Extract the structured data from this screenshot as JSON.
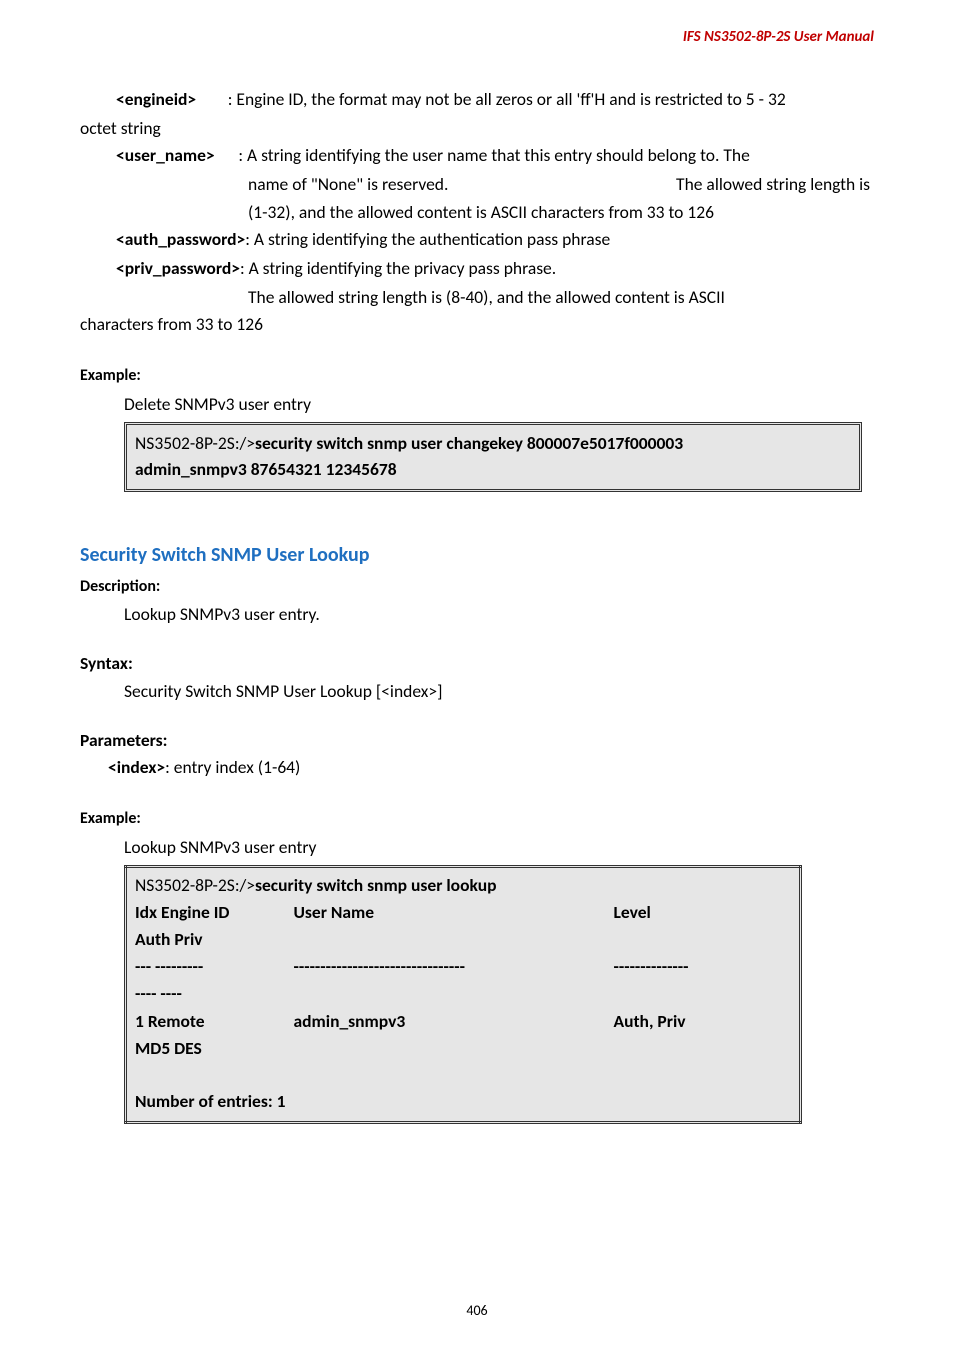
{
  "header": {
    "product": "IFS NS3502-8P-2S  User  Manual"
  },
  "params1": {
    "engineid": {
      "name": "<engineid>",
      "desc": ": Engine ID, the format may not be all zeros or all 'ff'H and is restricted to 5 - 32",
      "cont": "octet string"
    },
    "user_name": {
      "name": "<user_name>",
      "l1a": ": A string identifying the user name that this entry should belong to. The",
      "l2a": "name of \"None\" is reserved.",
      "l2b": "The allowed string length is",
      "l3": "(1-32), and the allowed content is ASCII characters from 33 to 126"
    },
    "auth_pw": {
      "name": "<auth_password>",
      "desc": ": A string identifying the authentication pass phrase"
    },
    "priv_pw": {
      "name": "<priv_password>",
      "desc": ": A string identifying the privacy pass phrase.",
      "cont": "The allowed string length is (8-40), and the allowed content is ASCII",
      "cont2": "characters from 33 to 126"
    }
  },
  "example1": {
    "label": "Example:",
    "intro": "Delete SNMPv3 user entry",
    "prompt": "NS3502-8P-2S:/>",
    "cmd1": "security switch snmp user changekey 800007e5017f000003",
    "cmd2": "admin_snmpv3 87654321 12345678"
  },
  "section2": {
    "title": "Security Switch SNMP User Lookup",
    "desc_label": "Description:",
    "desc_text": "Lookup SNMPv3 user entry.",
    "syntax_label": "Syntax:",
    "syntax_text": "Security Switch SNMP User Lookup [<index>]",
    "params_label": "Parameters:",
    "index_name": "<index>",
    "index_desc": ": entry index (1-64)",
    "example_label": "Example:",
    "example_intro": "Lookup SNMPv3 user entry"
  },
  "lookup_box": {
    "prompt": "NS3502-8P-2S:/>",
    "cmd": "security switch snmp user lookup",
    "h1": "Idx Engine ID",
    "h2": "User Name",
    "h3": "Level",
    "h4": "Auth    Priv",
    "sep1": "---   ---------",
    "sep2": "--------------------------------",
    "sep3": "--------------",
    "sep4": "----        ----",
    "r1c1": "1       Remote",
    "r1c2": "admin_snmpv3",
    "r1c3": "Auth, Priv",
    "r2": "MD5    DES",
    "footer": "Number of entries: 1"
  },
  "page_number": "406"
}
